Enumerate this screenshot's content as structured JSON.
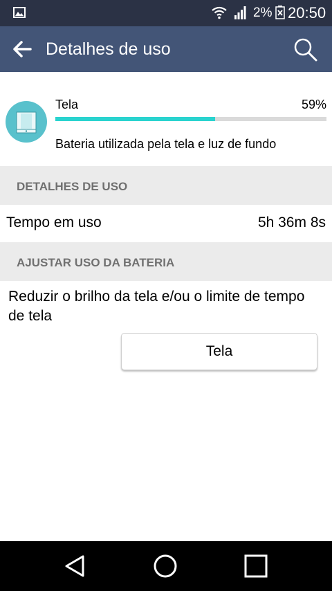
{
  "status_bar": {
    "battery_percent": "2%",
    "time": "20:50",
    "icons": [
      "gallery-icon",
      "wifi-icon",
      "signal-icon",
      "battery-icon"
    ]
  },
  "app_bar": {
    "title": "Detalhes de uso",
    "back_icon": "arrow-left-icon",
    "search_icon": "search-icon",
    "color": "#435577"
  },
  "usage": {
    "name": "Tela",
    "percent_label": "59%",
    "percent_value": 0.59,
    "description": "Bateria utilizada pela tela e luz de fundo",
    "icon": "screen-icon",
    "bar_color": "#2ad3cf"
  },
  "sections": {
    "details_header": "DETALHES DE USO",
    "adjust_header": "AJUSTAR USO DA BATERIA"
  },
  "details": {
    "label": "Tempo em uso",
    "value": "5h 36m 8s"
  },
  "adjust": {
    "text": "Reduzir o brilho da tela e/ou o limite de tempo de tela",
    "button_label": "Tela"
  },
  "nav_bar": {
    "icons": [
      "back-triangle-icon",
      "home-circle-icon",
      "recents-square-icon"
    ]
  }
}
